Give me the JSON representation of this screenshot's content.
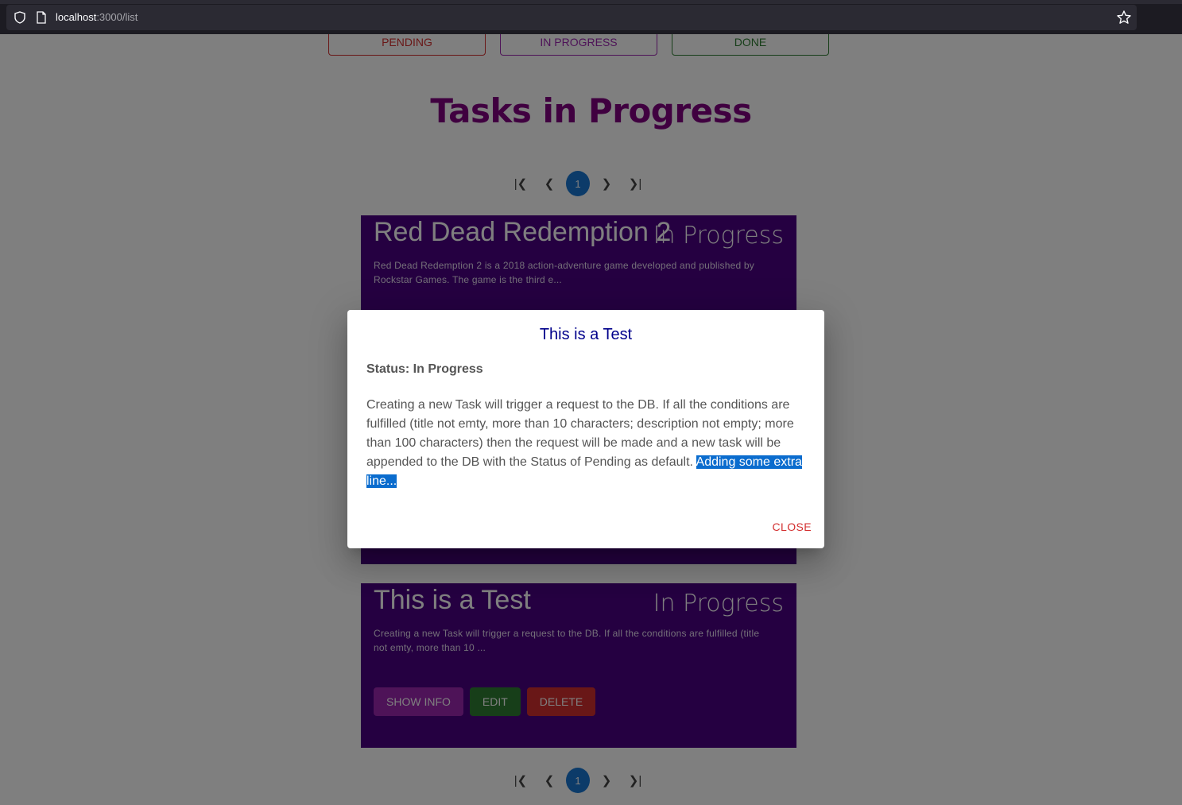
{
  "browser": {
    "url_host": "localhost",
    "url_rest": ":3000/list"
  },
  "filters": [
    {
      "label": "PENDING",
      "color": "#d32f2f"
    },
    {
      "label": "IN PROGRESS",
      "color": "#9c27b0"
    },
    {
      "label": "DONE",
      "color": "#2e7d32"
    }
  ],
  "page_title": "Tasks in Progress",
  "pagination": {
    "current_page": "1"
  },
  "tasks": [
    {
      "title": "Red Dead Redemption 2",
      "status": "In Progress",
      "description": "Red Dead Redemption 2 is a 2018 action-adventure game developed and published by Rockstar Games. The game is the third e..."
    },
    {
      "title": "This is a Test",
      "status": "In Progress",
      "description": "Creating a new Task will trigger a request to the DB. If all the conditions are fulfilled (title not emty, more than 10 ...",
      "buttons": {
        "show_info": "SHOW INFO",
        "edit": "EDIT",
        "delete": "DELETE"
      }
    }
  ],
  "dialog": {
    "title": "This is a Test",
    "status_label": "Status: In Progress",
    "body": "Creating a new Task will trigger a request to the DB. If all the conditions are fulfilled (title not emty, more than 10 characters; description not empty; more than 100 characters) then the request will be made and a new task will be appended to the DB with the Status of Pending as default. ",
    "body_selected": "Adding some extra line...",
    "close_label": "CLOSE"
  },
  "colors": {
    "card_bg": "#4b0082",
    "title_color": "#800080",
    "show_info_bg": "#9c27b0",
    "edit_bg": "#2e7d32",
    "delete_bg": "#d32f2f",
    "pager_active": "#1976d2"
  },
  "icons": [
    "shield-icon",
    "page-icon",
    "star-icon",
    "first-page-icon",
    "prev-page-icon",
    "next-page-icon",
    "last-page-icon"
  ]
}
